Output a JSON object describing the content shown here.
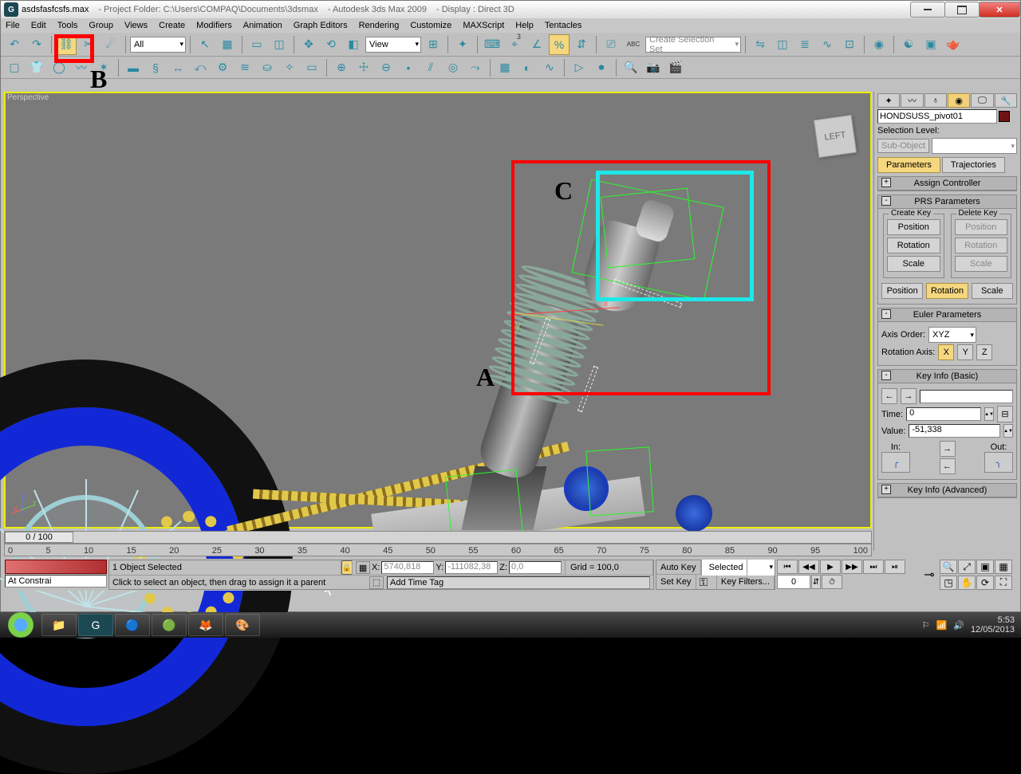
{
  "title": {
    "file": "asdsfasfcsfs.max",
    "folder": "- Project Folder: C:\\Users\\COMPAQ\\Documents\\3dsmax",
    "app": "- Autodesk 3ds Max  2009",
    "display": "- Display : Direct 3D"
  },
  "menu": [
    "File",
    "Edit",
    "Tools",
    "Group",
    "Views",
    "Create",
    "Modifiers",
    "Animation",
    "Graph Editors",
    "Rendering",
    "Customize",
    "MAXScript",
    "Help",
    "Tentacles"
  ],
  "toolbar1": {
    "dd_all": "All",
    "dd_view": "View",
    "sel_set": "Create Selection Set",
    "sup3": "3"
  },
  "viewport": {
    "label": "Perspective",
    "cube": "LEFT",
    "gizmo_x": "x",
    "gizmo_y": "y"
  },
  "annotations": {
    "A": "A",
    "B": "B",
    "C": "C"
  },
  "panel": {
    "object_name": "HONDSUSS_pivot01",
    "sel_level": "Selection Level:",
    "sub_object": "Sub-Object",
    "parameters": "Parameters",
    "trajectories": "Trajectories",
    "assign": "Assign Controller",
    "prs": "PRS Parameters",
    "create_key": "Create Key",
    "delete_key": "Delete Key",
    "position": "Position",
    "rotation": "Rotation",
    "scale": "Scale",
    "euler": "Euler Parameters",
    "axis_order_l": "Axis Order:",
    "axis_order": "XYZ",
    "rot_axis": "Rotation Axis:",
    "x": "X",
    "y": "Y",
    "z": "Z",
    "key_info": "Key Info (Basic)",
    "time_l": "Time:",
    "time": "0",
    "value_l": "Value:",
    "value": "-51,338",
    "in": "In:",
    "out": "Out:",
    "key_adv": "Key Info (Advanced)"
  },
  "time": {
    "slider": "0 / 100",
    "ticks": [
      "0",
      "5",
      "10",
      "15",
      "20",
      "25",
      "30",
      "35",
      "40",
      "45",
      "50",
      "55",
      "60",
      "65",
      "70",
      "75",
      "80",
      "85",
      "90",
      "95",
      "100"
    ]
  },
  "status": {
    "script": "At Constrai",
    "sel": "1 Object Selected",
    "x_l": "X:",
    "x": "5740,818",
    "y_l": "Y:",
    "y": "-111082,38",
    "z_l": "Z:",
    "z": "0,0",
    "grid": "Grid = 100,0",
    "hint": "Click to select an object, then drag to assign it a parent",
    "add_tag": "Add Time Tag",
    "auto": "Auto Key",
    "setk": "Set Key",
    "selected": "Selected",
    "kfilters": "Key Filters...",
    "frame": "0"
  },
  "tray": {
    "time": "5:53",
    "date": "12/05/2013"
  }
}
